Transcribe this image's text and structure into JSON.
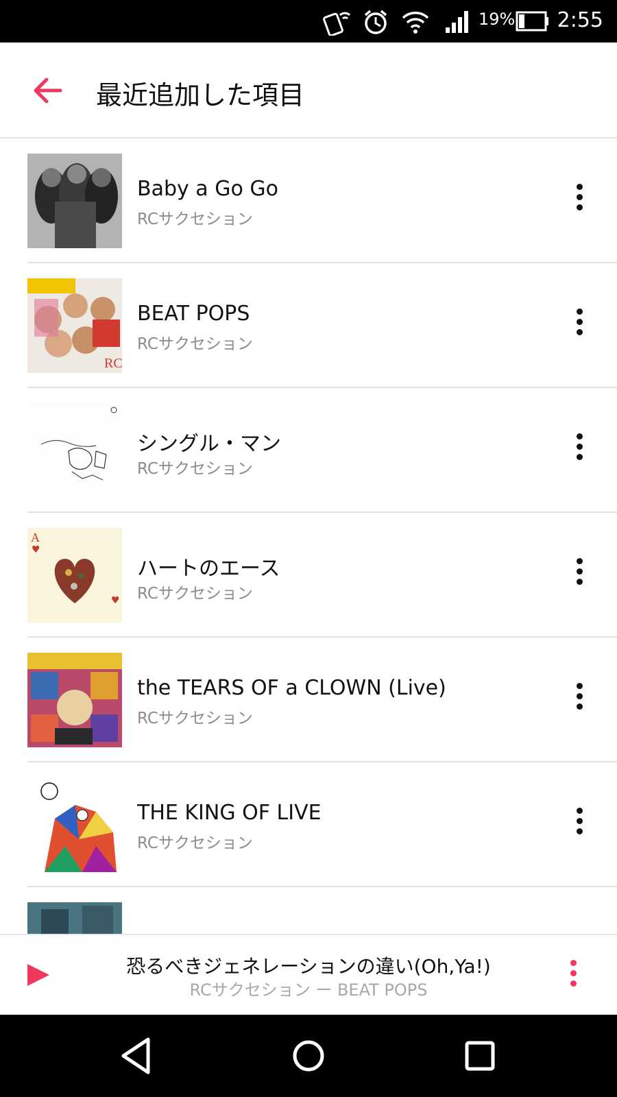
{
  "status_bar": {
    "battery": "19%",
    "time": "2:55",
    "icons": [
      "nfc-phone-icon",
      "alarm-icon",
      "wifi-icon",
      "signal-icon",
      "battery-icon"
    ]
  },
  "header": {
    "back_icon": "arrow-left-icon",
    "title": "最近追加した項目"
  },
  "items": [
    {
      "title": "Baby a Go Go",
      "artist": "RCサクセション"
    },
    {
      "title": "BEAT POPS",
      "artist": "RCサクセション"
    },
    {
      "title": "シングル・マン",
      "artist": "RCサクセション"
    },
    {
      "title": "ハートのエース",
      "artist": "RCサクセション"
    },
    {
      "title": "the TEARS OF a CLOWN (Live)",
      "artist": "RCサクセション"
    },
    {
      "title": "THE KING OF LIVE",
      "artist": "RCサクセション"
    }
  ],
  "now_playing": {
    "title": "恐るべきジェネレーションの違い(Oh,Ya!)",
    "subtitle": "RCサクセション ー BEAT POPS"
  },
  "colors": {
    "accent": "#f0385f",
    "status_bar": "#000000",
    "text_primary": "#111111",
    "text_secondary": "#8c8c8c"
  }
}
